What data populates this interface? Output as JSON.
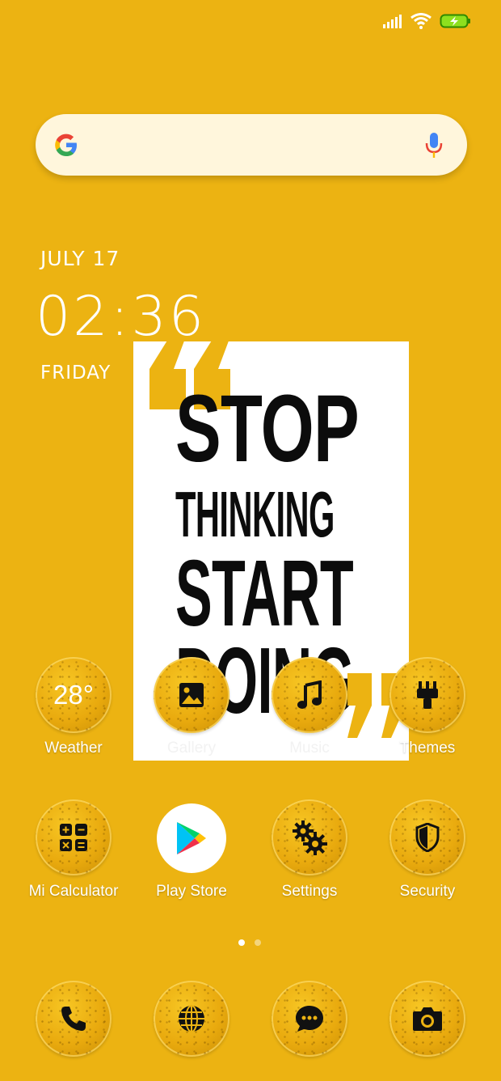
{
  "status_bar": {
    "icons": [
      "signal-icon",
      "wifi-icon",
      "battery-charging-icon"
    ]
  },
  "search_bar": {
    "icons": [
      "google-g-icon",
      "mic-icon"
    ]
  },
  "clock_widget": {
    "date": "JULY 17",
    "time": "02:36",
    "day": "FRIDAY"
  },
  "poster": {
    "lines": [
      "STOP",
      "THINKING",
      "START",
      "DOING"
    ]
  },
  "apps_row1": [
    {
      "label": "Weather",
      "value": "28°"
    },
    {
      "label": "Gallery"
    },
    {
      "label": "Music"
    },
    {
      "label": "Themes"
    }
  ],
  "apps_row2": [
    {
      "label": "Mi Calculator"
    },
    {
      "label": "Play Store"
    },
    {
      "label": "Settings"
    },
    {
      "label": "Security"
    }
  ],
  "dock": [
    "phone-icon",
    "browser-icon",
    "messages-icon",
    "camera-icon"
  ],
  "page_indicator": {
    "count": 2,
    "active": 1
  },
  "colors": {
    "background": "#ecb312",
    "poster_text": "#0c0c0c"
  }
}
